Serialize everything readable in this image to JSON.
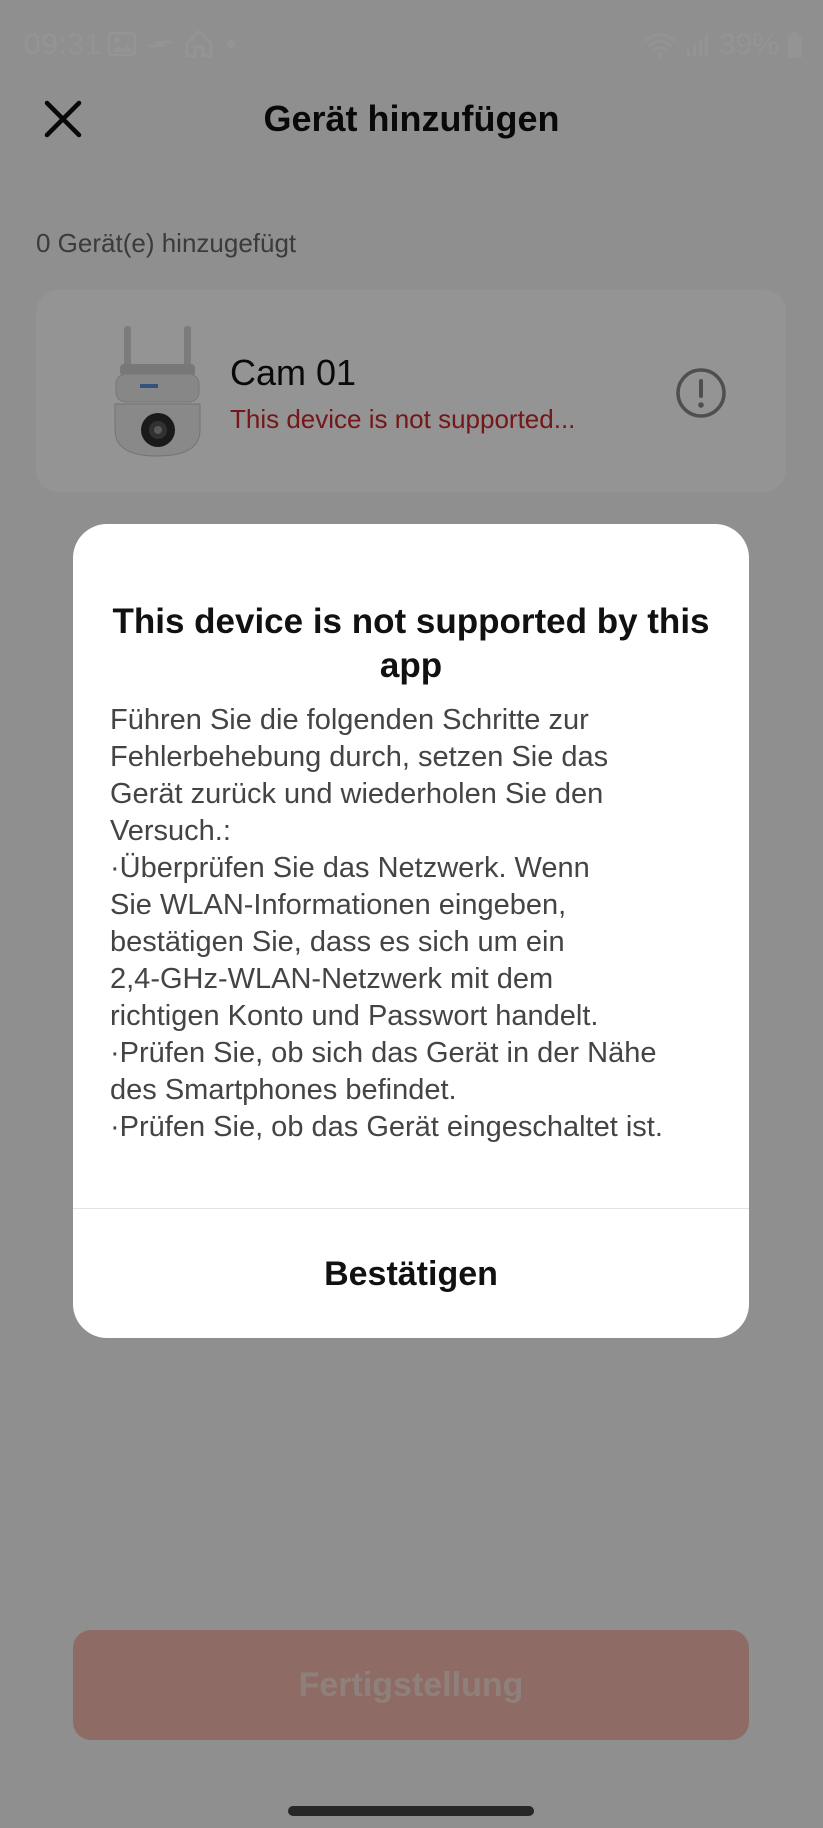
{
  "status_bar": {
    "time": "09:31",
    "battery": "39%",
    "left_icons": [
      "image-icon",
      "data-transfer-icon",
      "home-icon",
      "dot-icon"
    ],
    "right_icons": [
      "wifi-icon",
      "signal-icon",
      "battery-icon"
    ]
  },
  "header": {
    "title": "Gerät hinzufügen",
    "close_icon": "close-icon"
  },
  "added_count": "0 Gerät(e) hinzugefügt",
  "device": {
    "name": "Cam 01",
    "status": "This device is not supported...",
    "image_icon": "camera-icon",
    "warning_icon": "exclamation-circle-icon"
  },
  "dialog": {
    "title": "This device is not supported by this app",
    "body": "Führen Sie die folgenden Schritte zur\nFehlerbehebung durch, setzen Sie das\nGerät zurück und wiederholen Sie den\nVersuch.:\n·Überprüfen Sie das Netzwerk. Wenn\nSie WLAN-Informationen eingeben,\nbestätigen Sie, dass es sich um ein\n2,4-GHz-WLAN-Netzwerk mit dem\nrichtigen Konto und Passwort handelt.\n·Prüfen Sie, ob sich das Gerät in der Nähe\ndes Smartphones befindet.\n·Prüfen Sie, ob das Gerät eingeschaltet ist.",
    "confirm_label": "Bestätigen"
  },
  "footer": {
    "finish_label": "Fertigstellung"
  },
  "colors": {
    "error_text": "#c8282c",
    "finish_button": "#f5b9ad",
    "overlay": "rgba(0,0,0,0.42)"
  }
}
